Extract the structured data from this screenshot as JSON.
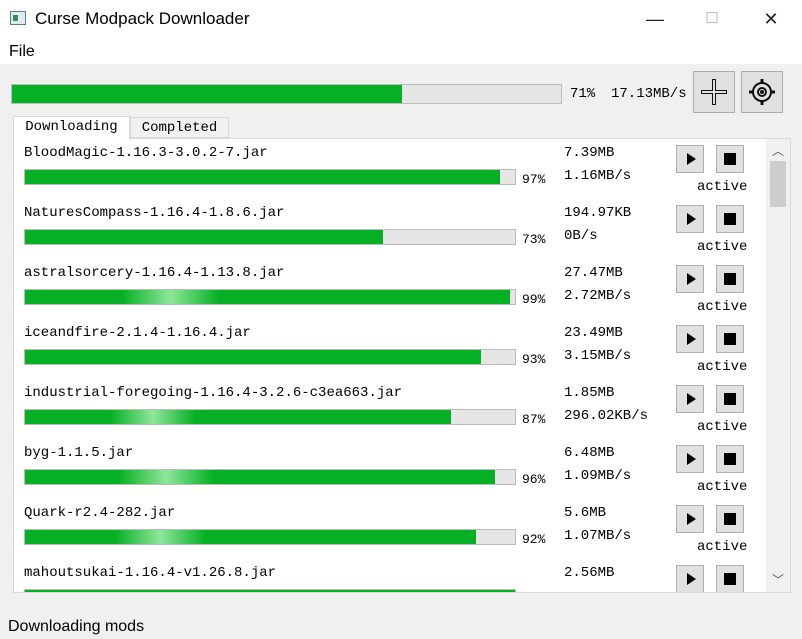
{
  "window": {
    "title": "Curse Modpack Downloader",
    "minimize": "—",
    "maximize": "☐",
    "close": "✕"
  },
  "menu": {
    "file": "File"
  },
  "overall": {
    "progress": 71,
    "percent_text": "71%",
    "speed_text": "17.13MB/s"
  },
  "toolbar": {
    "add_icon": "add-icon",
    "settings_icon": "gear-icon"
  },
  "tabs": [
    {
      "label": "Downloading",
      "active": true
    },
    {
      "label": "Completed",
      "active": false
    }
  ],
  "items": [
    {
      "name": "BloodMagic-1.16.3-3.0.2-7.jar",
      "progress": 97,
      "percent": "97%",
      "size": "7.39MB",
      "speed": "1.16MB/s",
      "status": "active"
    },
    {
      "name": "NaturesCompass-1.16.4-1.8.6.jar",
      "progress": 73,
      "percent": "73%",
      "size": "194.97KB",
      "speed": "0B/s",
      "status": "active"
    },
    {
      "name": "astralsorcery-1.16.4-1.13.8.jar",
      "progress": 99,
      "percent": "99%",
      "size": "27.47MB",
      "speed": "2.72MB/s",
      "status": "active"
    },
    {
      "name": "iceandfire-2.1.4-1.16.4.jar",
      "progress": 93,
      "percent": "93%",
      "size": "23.49MB",
      "speed": "3.15MB/s",
      "status": "active"
    },
    {
      "name": "industrial-foregoing-1.16.4-3.2.6-c3ea663.jar",
      "progress": 87,
      "percent": "87%",
      "size": "1.85MB",
      "speed": "296.02KB/s",
      "status": "active"
    },
    {
      "name": "byg-1.1.5.jar",
      "progress": 96,
      "percent": "96%",
      "size": "6.48MB",
      "speed": "1.09MB/s",
      "status": "active"
    },
    {
      "name": "Quark-r2.4-282.jar",
      "progress": 92,
      "percent": "92%",
      "size": "5.6MB",
      "speed": "1.07MB/s",
      "status": "active"
    },
    {
      "name": "mahoutsukai-1.16.4-v1.26.8.jar",
      "progress": 100,
      "percent": "",
      "size": "2.56MB",
      "speed": "",
      "status": ""
    }
  ],
  "statusbar": {
    "text": "Downloading mods"
  },
  "colors": {
    "progress": "#06b025",
    "track": "#e6e6e6"
  }
}
